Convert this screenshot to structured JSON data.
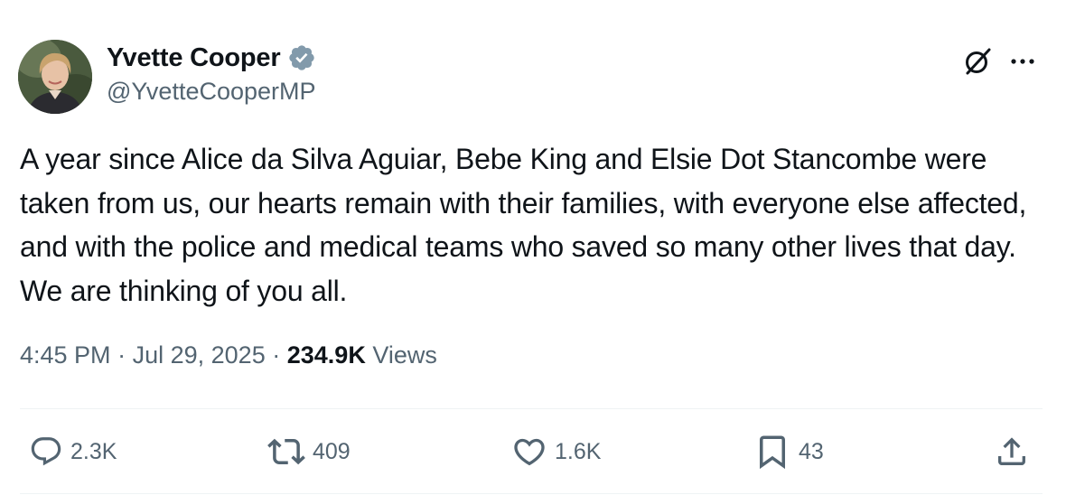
{
  "author": {
    "display_name": "Yvette Cooper",
    "handle": "@YvetteCooperMP",
    "verified": true,
    "verified_color": "#829aab"
  },
  "header_icons": [
    "grok-icon",
    "more-icon"
  ],
  "tweet": {
    "text": "A year since Alice da Silva Aguiar, Bebe King and Elsie Dot Stancombe were taken from us, our hearts remain with their families, with everyone else affected, and with the police and medical teams who saved so many other lives that day. We are thinking of you all."
  },
  "meta": {
    "time": "4:45 PM",
    "separator": "·",
    "date": "Jul 29, 2025",
    "views_count": "234.9K",
    "views_label": "Views"
  },
  "actions": {
    "replies": "2.3K",
    "reposts": "409",
    "likes": "1.6K",
    "bookmarks": "43"
  },
  "colors": {
    "text": "#0f1419",
    "secondary_text": "#536471",
    "divider": "#eff3f4"
  }
}
